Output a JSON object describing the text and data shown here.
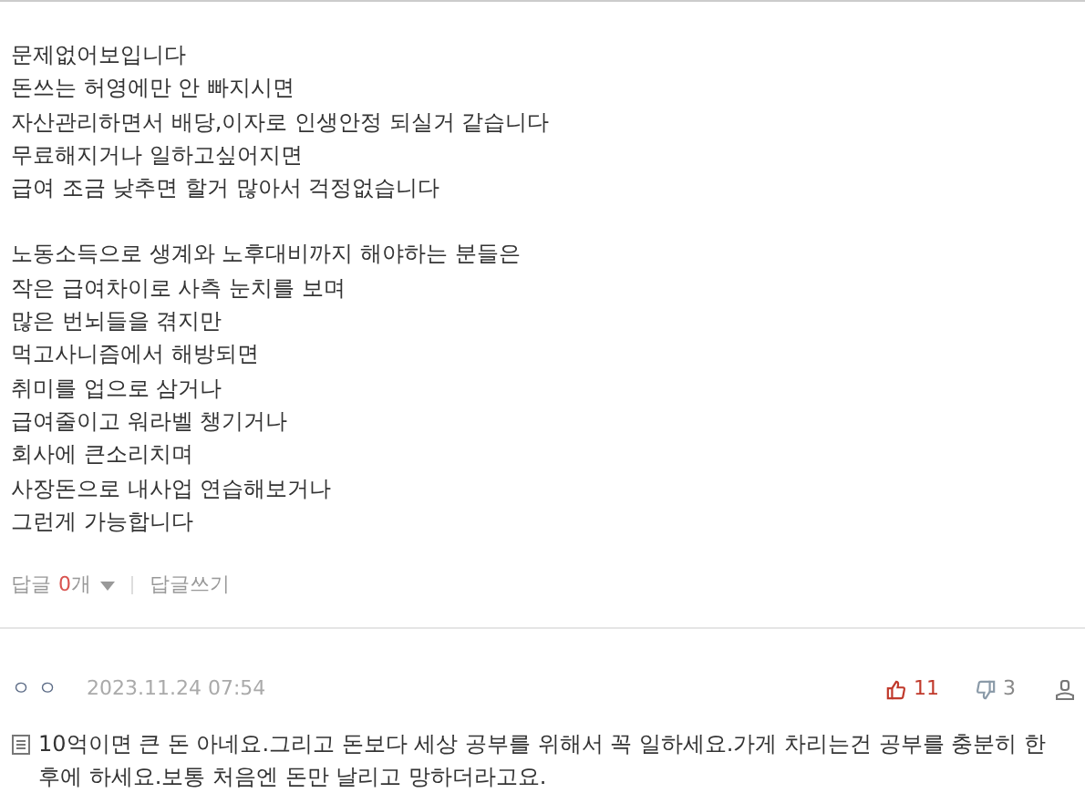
{
  "comments": [
    {
      "has_memo_icon": false,
      "paragraphs": [
        [
          "문제없어보입니다",
          "돈쓰는 허영에만 안 빠지시면",
          "자산관리하면서 배당,이자로 인생안정 되실거 같습니다",
          "무료해지거나 일하고싶어지면",
          "급여 조금 낮추면 할거 많아서 걱정없습니다"
        ],
        [
          "노동소득으로 생계와 노후대비까지 해야하는 분들은",
          "작은 급여차이로 사측 눈치를 보며",
          "많은 번뇌들을 겪지만",
          "먹고사니즘에서 해방되면",
          "취미를 업으로 삼거나",
          "급여줄이고 워라벨 챙기거나",
          "회사에 큰소리치며",
          "사장돈으로 내사업 연습해보거나",
          "그런게 가능합니다"
        ]
      ],
      "reply_label": "답글",
      "reply_count": "0",
      "reply_unit": "개",
      "write_reply": "답글쓰기"
    },
    {
      "author": "ㅇ ㅇ",
      "date": "2023.11.24 07:54",
      "likes": "11",
      "dislikes": "3",
      "has_memo_icon": true,
      "paragraphs": [
        [
          "10억이면 큰 돈 아네요.그리고 돈보다 세상 공부를 위해서 꼭 일하세요.가게 차리는건 공부를 충분히 한 후에 하세요.보통 처음엔 돈만 날리고 망하더라고요."
        ]
      ]
    }
  ]
}
